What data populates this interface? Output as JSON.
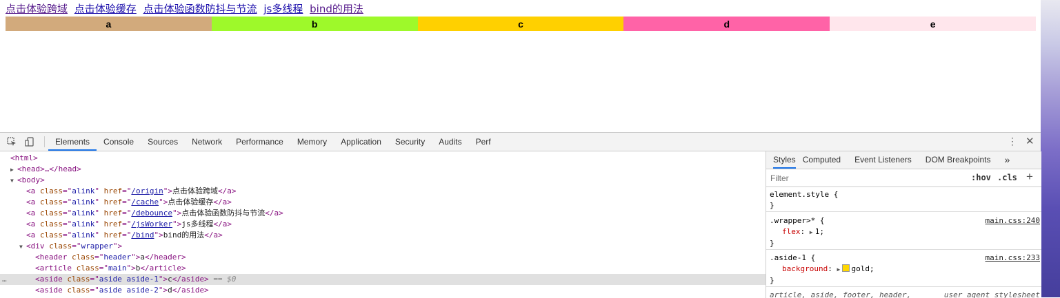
{
  "links": [
    "点击体验跨域",
    "点击体验缓存",
    "点击体验函数防抖与节流",
    "js多线程",
    "bind的用法"
  ],
  "boxes": {
    "header": "a",
    "main": "b",
    "aside1": "c",
    "aside2": "d",
    "footer": "e"
  },
  "colors": {
    "header": "#d2aa7c",
    "main": "#9ef92a",
    "aside1": "#ffd000",
    "aside2": "#ff63a7",
    "footer": "#ffe6ec",
    "tab_accent": "#1a73e8"
  },
  "devtools": {
    "tabs": [
      "Elements",
      "Console",
      "Sources",
      "Network",
      "Performance",
      "Memory",
      "Application",
      "Security",
      "Audits",
      "Perf"
    ],
    "active_tab": "Elements",
    "dom": {
      "html_open": "<html>",
      "head": "<head>…</head>",
      "body_open": "<body>",
      "a1": {
        "cls": "alink",
        "href": "/origin",
        "text": "点击体验跨域"
      },
      "a2": {
        "cls": "alink",
        "href": "/cache",
        "text": "点击体验缓存"
      },
      "a3": {
        "cls": "alink",
        "href": "/debounce",
        "text": "点击体验函数防抖与节流"
      },
      "a4": {
        "cls": "alink",
        "href": "/jsWorker",
        "text": "js多线程"
      },
      "a5": {
        "cls": "alink",
        "href": "/bind",
        "text": "bind的用法"
      },
      "wrapper_cls": "wrapper",
      "header": {
        "cls": "header",
        "text": "a"
      },
      "article": {
        "cls": "main",
        "text": "b"
      },
      "aside1": {
        "cls": "aside aside-1",
        "text": "c",
        "marker": "== $0"
      },
      "aside2": {
        "cls": "aside aside-2",
        "text": "d"
      }
    },
    "styles": {
      "tabs": [
        "Styles",
        "Computed",
        "Event Listeners",
        "DOM Breakpoints"
      ],
      "more": "»",
      "filter_placeholder": "Filter",
      "hov": ":hov",
      "cls": ".cls",
      "plus": "+",
      "rules": {
        "element_style": "element.style {",
        "wrapper_selector": ".wrapper>* {",
        "wrapper_src": "main.css:240",
        "wrapper_prop": "flex",
        "wrapper_val": "1;",
        "aside_selector": ".aside-1 {",
        "aside_src": "main.css:233",
        "aside_prop": "background",
        "aside_val": "gold;",
        "ua_selector": "article, aside, footer, header,",
        "ua_label": "user agent stylesheet",
        "close_brace": "}"
      }
    }
  }
}
